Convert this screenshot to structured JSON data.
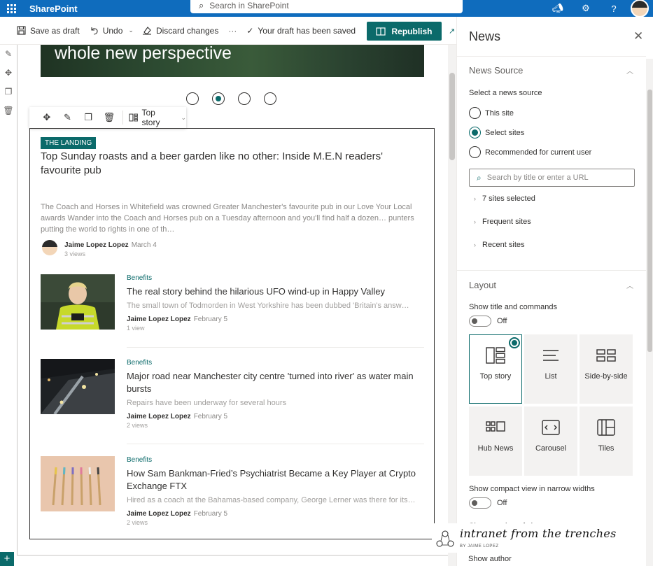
{
  "suite": {
    "app_name": "SharePoint",
    "search_placeholder": "Search in SharePoint"
  },
  "commandbar": {
    "save_draft": "Save as draft",
    "undo": "Undo",
    "discard": "Discard changes",
    "more": "···",
    "draft_status": "Your draft has been saved",
    "republish": "Republish"
  },
  "canvas": {
    "hero_text": "whole new perspective",
    "carousel_active_index": 2,
    "toolbar_layout": "Top story"
  },
  "news": {
    "top_story": {
      "tag": "THE LANDING",
      "title": "Top Sunday roasts and a beer garden like no other: Inside M.E.N readers' favourite pub",
      "description": "The Coach and Horses in Whitefield was crowned Greater Manchester's favourite pub in our Love Your Local awards Wander into the Coach and Horses pub on a Tuesday afternoon and you'll find half a dozen… punters putting the world to rights in one of th…",
      "author": "Jaime Lopez Lopez",
      "date": "March 4",
      "views": "3 views"
    },
    "items": [
      {
        "category": "Benefits",
        "title": "The real story behind the hilarious UFO wind-up in Happy Valley",
        "description": "The small town of Todmorden in West Yorkshire has been dubbed 'Britain's answ…",
        "author": "Jaime Lopez Lopez",
        "date": "February 5",
        "views": "1 view"
      },
      {
        "category": "Benefits",
        "title": "Major road near Manchester city centre 'turned into river' as water main bursts",
        "description": "Repairs have been underway for several hours",
        "author": "Jaime Lopez Lopez",
        "date": "February 5",
        "views": "2 views"
      },
      {
        "category": "Benefits",
        "title": "How Sam Bankman-Fried’s Psychiatrist Became a Key Player at Crypto Exchange FTX",
        "description": "Hired as a coach at the Bahamas-based company, George Lerner was there for its…",
        "author": "Jaime Lopez Lopez",
        "date": "February 5",
        "views": "2 views"
      }
    ]
  },
  "pane": {
    "title": "News",
    "source_section": "News Source",
    "select_label": "Select a news source",
    "radio_this_site": "This site",
    "radio_select_sites": "Select sites",
    "radio_recommended": "Recommended for current user",
    "search_placeholder": "Search by title or enter a URL",
    "tree_selected": "7 sites selected",
    "tree_frequent": "Frequent sites",
    "tree_recent": "Recent sites",
    "layout_section": "Layout",
    "show_title_label": "Show title and commands",
    "show_title_state": "Off",
    "layouts": [
      "Top story",
      "List",
      "Side-by-side",
      "Hub News",
      "Carousel",
      "Tiles"
    ],
    "compact_label": "Show compact view in narrow widths",
    "compact_state": "Off",
    "cut_label": "Show number of views",
    "show_author": "Show author"
  },
  "watermark": {
    "text": "intranet from the trenches",
    "sub": "BY JAIME LOPEZ"
  },
  "colors": {
    "suite_blue": "#0f6cbd",
    "accent_teal": "#0b6a6a"
  }
}
